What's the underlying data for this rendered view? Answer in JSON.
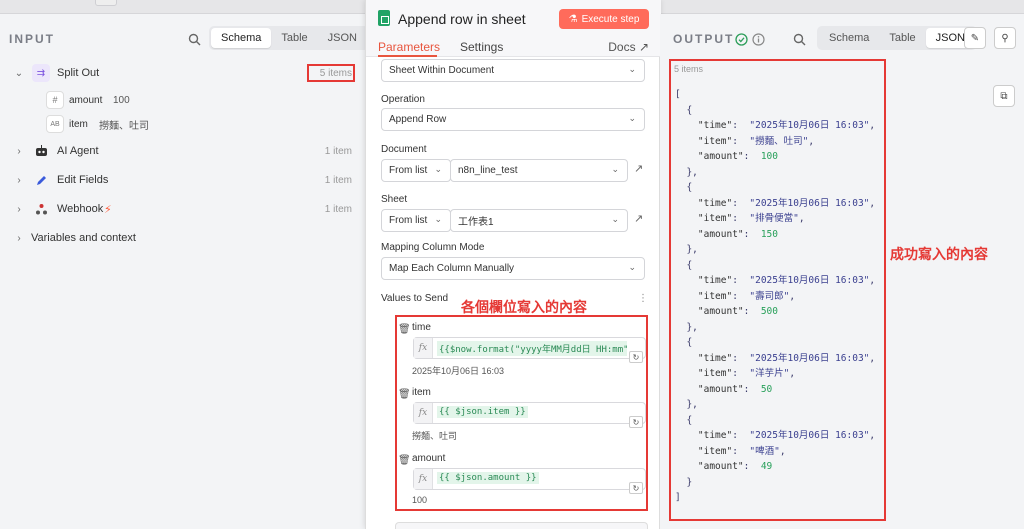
{
  "input": {
    "title": "INPUT",
    "tabs": [
      "Schema",
      "Table",
      "JSON"
    ],
    "split_out": {
      "label": "Split Out",
      "count": "5 items"
    },
    "fields": [
      {
        "type_icon": "#",
        "name": "amount",
        "value": "100"
      },
      {
        "type_icon": "AB",
        "name": "item",
        "value": "撈麵、吐司"
      }
    ],
    "nodes": [
      {
        "label": "AI Agent",
        "count": "1 item"
      },
      {
        "label": "Edit Fields",
        "count": "1 item"
      },
      {
        "label": "Webhook",
        "count": "1 item"
      }
    ],
    "variables": "Variables and context"
  },
  "modal": {
    "title": "Append row in sheet",
    "execute": "Execute step",
    "tabs": [
      "Parameters",
      "Settings"
    ],
    "docs": "Docs",
    "doc_selector": "Sheet Within Document",
    "operation_label": "Operation",
    "operation_value": "Append Row",
    "document_label": "Document",
    "document_mode": "From list",
    "document_value": "n8n_line_test",
    "sheet_label": "Sheet",
    "sheet_mode": "From list",
    "sheet_value": "工作表1",
    "mapping_label": "Mapping Column Mode",
    "mapping_value": "Map Each Column Manually",
    "values_label": "Values to Send",
    "values": [
      {
        "name": "time",
        "expr": "{{$now.format(\"yyyy年MM月dd日 HH:mm\")}}",
        "result": "2025年10月06日 16:03"
      },
      {
        "name": "item",
        "expr": "{{ $json.item }}",
        "result": "撈麵、吐司"
      },
      {
        "name": "amount",
        "expr": "{{ $json.amount }}",
        "result": "100"
      }
    ]
  },
  "annotations": {
    "values": "各個欄位寫入的內容",
    "output": "成功寫入的內容"
  },
  "output": {
    "title": "OUTPUT",
    "tabs": [
      "Schema",
      "Table",
      "JSON"
    ],
    "count": "5 items",
    "records": [
      {
        "time": "2025年10月06日 16:03",
        "item": "撈麵、吐司",
        "amount": 100
      },
      {
        "time": "2025年10月06日 16:03",
        "item": "排骨便當",
        "amount": 150
      },
      {
        "time": "2025年10月06日 16:03",
        "item": "壽司郎",
        "amount": 500
      },
      {
        "time": "2025年10月06日 16:03",
        "item": "洋芋片",
        "amount": 50
      },
      {
        "time": "2025年10月06日 16:03",
        "item": "啤酒",
        "amount": 49
      }
    ]
  },
  "colors": {
    "accent": "#e8553e",
    "execute": "#ff6b5b",
    "annotation": "#e53935",
    "sheets_green": "#21a366"
  }
}
